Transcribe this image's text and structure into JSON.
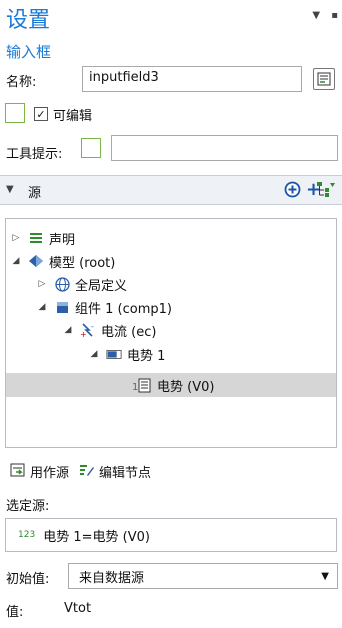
{
  "header": {
    "title": "设置",
    "subtitle": "输入框",
    "menu_icon": "triangle-down-icon",
    "pin_icon": "pin-icon"
  },
  "form": {
    "name_label": "名称:",
    "name_value": "inputfield3",
    "editable_label": "可编辑",
    "editable_checked": true,
    "tooltip_label": "工具提示:",
    "tooltip_value": ""
  },
  "source_section": {
    "label": "源",
    "add_circle_icon": "plus-circle-icon",
    "add_icon": "plus-icon",
    "tree_icon": "tree-filter-icon"
  },
  "tree": {
    "items": [
      {
        "label": "声明",
        "icon": "list-icon",
        "expanded": false
      },
      {
        "label": "模型 (root)",
        "icon": "model-icon",
        "expanded": true
      },
      {
        "label": "全局定义",
        "icon": "globe-icon",
        "expanded": false
      },
      {
        "label": "组件 1 (comp1)",
        "icon": "component-icon",
        "expanded": true
      },
      {
        "label": "电流 (ec)",
        "icon": "current-icon",
        "expanded": true
      },
      {
        "label": "电势 1",
        "icon": "potential-icon",
        "expanded": true
      },
      {
        "label": "电势 (V0)",
        "icon": "parameter-icon",
        "selected": true
      }
    ]
  },
  "actions": {
    "use_as_source": "用作源",
    "edit_node": "编辑节点"
  },
  "selected_source": {
    "label": "选定源:",
    "badge": "123",
    "value": "电势 1=电势 (V0)"
  },
  "initial": {
    "label": "初始值:",
    "selected": "来自数据源"
  },
  "value": {
    "label": "值:",
    "text": "Vtot"
  },
  "colors": {
    "accent": "#1a7ad6",
    "green": "#2e8b2e",
    "selection": "#d6d6d6"
  }
}
